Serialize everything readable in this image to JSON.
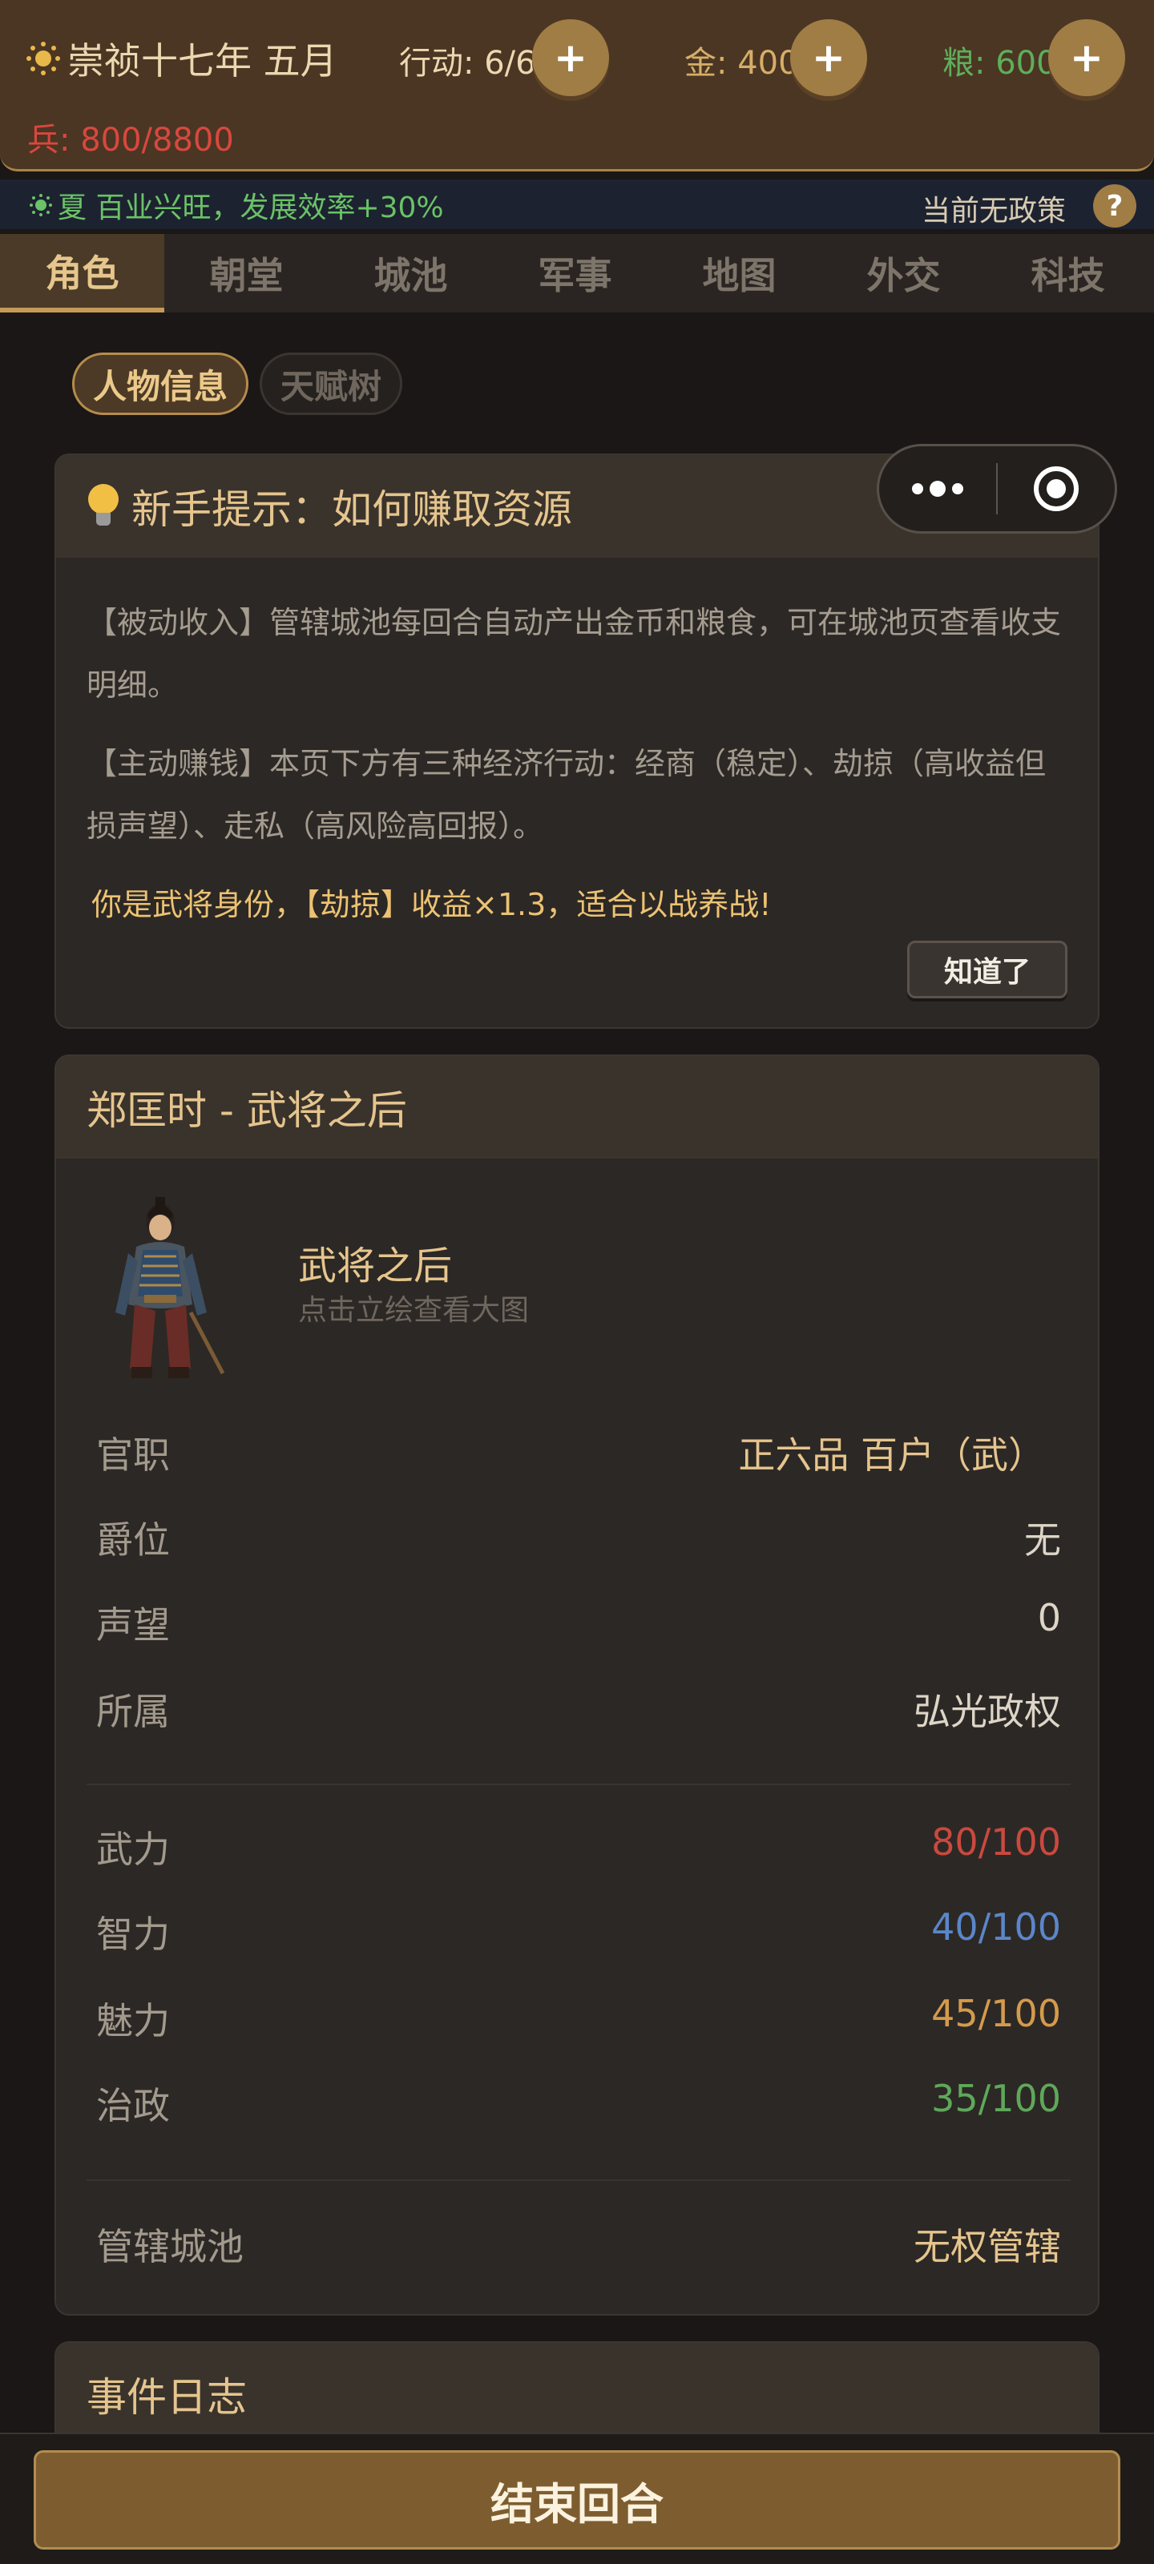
{
  "header": {
    "date": "崇祯十七年 五月",
    "actions": "行动: 6/6",
    "gold": "金: 400",
    "grain": "粮: 600",
    "soldiers": "兵: 800/8800",
    "plus_label": "+"
  },
  "season": {
    "text": "夏 百业兴旺，发展效率+30%",
    "policy": "当前无政策",
    "help_label": "?"
  },
  "tabs": [
    {
      "label": "角色"
    },
    {
      "label": "朝堂"
    },
    {
      "label": "城池"
    },
    {
      "label": "军事"
    },
    {
      "label": "地图"
    },
    {
      "label": "外交"
    },
    {
      "label": "科技"
    }
  ],
  "subtabs": [
    {
      "label": "人物信息"
    },
    {
      "label": "天赋树"
    }
  ],
  "tip": {
    "title": "新手提示：如何赚取资源",
    "p1": "【被动收入】管辖城池每回合自动产出金币和粮食，可在城池页查看收支明细。",
    "p2": "【主动赚钱】本页下方有三种经济行动：经商（稳定）、劫掠（高收益但损声望）、走私（高风险高回报）。",
    "highlight": "你是武将身份，【劫掠】收益×1.3，适合以战养战!",
    "button": "知道了"
  },
  "character": {
    "title": "郑匡时 - 武将之后",
    "profile_title": "武将之后",
    "profile_sub": "点击立绘查看大图",
    "info": [
      {
        "label": "官职",
        "value": "正六品 百户（武）"
      },
      {
        "label": "爵位",
        "value": "无"
      },
      {
        "label": "声望",
        "value": "0"
      },
      {
        "label": "所属",
        "value": "弘光政权"
      }
    ],
    "attributes": [
      {
        "label": "武力",
        "value": "80/100",
        "color": "#c9493f"
      },
      {
        "label": "智力",
        "value": "40/100",
        "color": "#5b86c9"
      },
      {
        "label": "魅力",
        "value": "45/100",
        "color": "#d49a4c"
      },
      {
        "label": "治政",
        "value": "35/100",
        "color": "#5fa85a"
      }
    ],
    "city_label": "管辖城池",
    "city_value": "无权管辖"
  },
  "events": {
    "title": "事件日志"
  },
  "footer": {
    "end_turn": "结束回合"
  },
  "colors": {
    "accent": "#c49a56",
    "header_bg": "#4a3623",
    "page_bg": "#1a1716"
  }
}
